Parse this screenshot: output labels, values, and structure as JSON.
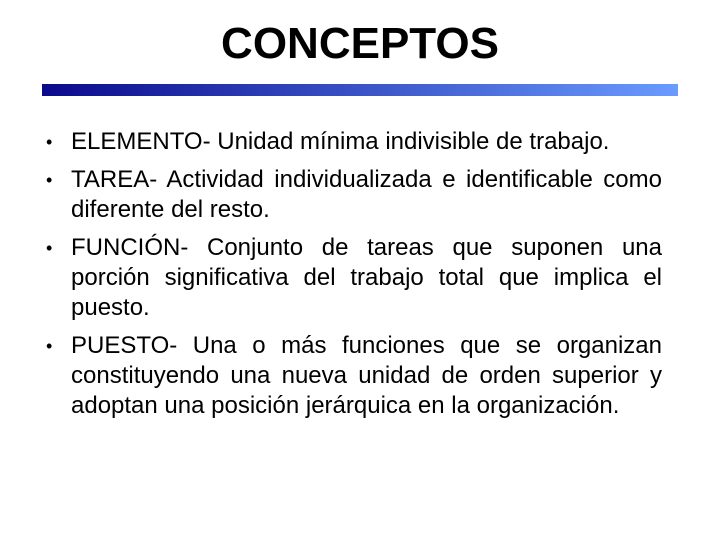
{
  "slide": {
    "title": "CONCEPTOS",
    "accent_bar_colors": [
      "#0a0a8c",
      "#6a9bff"
    ],
    "bullet_glyph": "•",
    "items": [
      {
        "text": "ELEMENTO- Unidad mínima indivisible de trabajo."
      },
      {
        "text": "TAREA- Actividad individualizada e identificable como diferente del resto."
      },
      {
        "text": "FUNCIÓN- Conjunto de tareas que suponen una porción significativa del trabajo total que implica el puesto."
      },
      {
        "text": "PUESTO- Una o más funciones que se organizan constituyendo una nueva unidad de orden superior y adoptan una posición jerárquica en la organización."
      }
    ]
  }
}
